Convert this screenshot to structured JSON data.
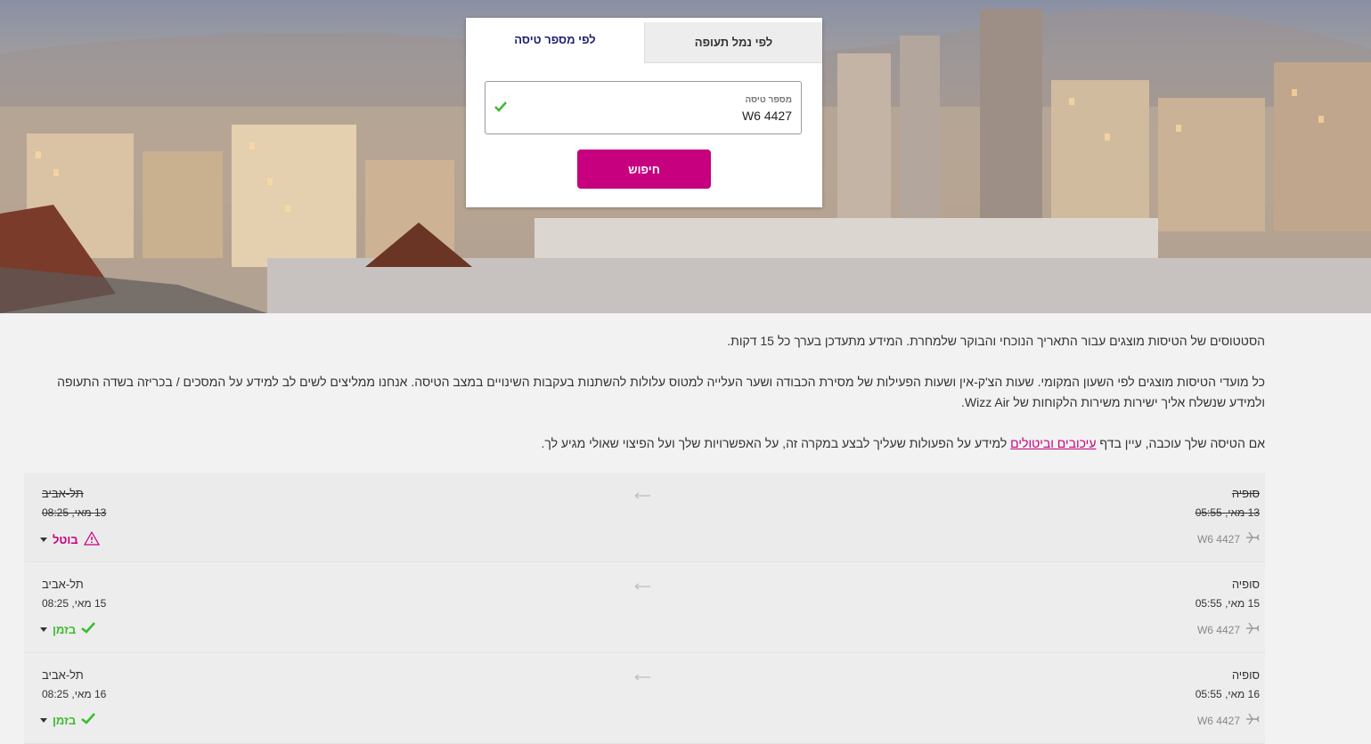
{
  "search": {
    "tab_by_flight": "לפי מספר טיסה",
    "tab_by_airport": "לפי נמל תעופה",
    "field_label": "מספר טיסה",
    "field_value": "W6 4427",
    "button_label": "חיפוש"
  },
  "info": {
    "line1": "הסטטוסים של הטיסות מוצגים עבור התאריך הנוכחי והבוקר שלמחרת. המידע מתעדכן בערך כל 15 דקות.",
    "line2": "כל מועדי הטיסות מוצגים לפי השעון המקומי. שעות הצ'ק-אין ושעות הפעילות של מסירת הכבודה ושער העלייה למטוס עלולות להשתנות בעקבות השינויים במצב הטיסה. אנחנו ממליצים לשים לב למידע על המסכים / בכריזה בשדה התעופה ולמידע שנשלח אליך ישירות משירות הלקוחות של Wizz Air.",
    "line3_before": "אם הטיסה שלך עוכבה, עיין בדף ",
    "line3_link": "עיכובים וביטולים",
    "line3_after": " למידע על הפעולות שעליך לבצע במקרה זה, על האפשרויות שלך ועל הפיצוי שאולי מגיע לך."
  },
  "flights": [
    {
      "departure_city": "סופיה",
      "departure_time": "13 מאי, 05:55",
      "arrival_city": "תל-אביב",
      "arrival_time": "13 מאי, 08:25",
      "flight_number": "W6 4427",
      "status": "בוטל",
      "status_kind": "cancelled"
    },
    {
      "departure_city": "סופיה",
      "departure_time": "15 מאי, 05:55",
      "arrival_city": "תל-אביב",
      "arrival_time": "15 מאי, 08:25",
      "flight_number": "W6 4427",
      "status": "בזמן",
      "status_kind": "on-time"
    },
    {
      "departure_city": "סופיה",
      "departure_time": "16 מאי, 05:55",
      "arrival_city": "תל-אביב",
      "arrival_time": "16 מאי, 08:25",
      "flight_number": "W6 4427",
      "status": "בזמן",
      "status_kind": "on-time"
    }
  ],
  "colors": {
    "brand": "#c6007e",
    "on_time": "#3dbb2f",
    "tab_active_text": "#1f1f6b"
  },
  "icons": {
    "field_valid": "check-icon",
    "route": "arrow-left-icon",
    "flight": "airplane-icon",
    "cancelled": "warning-icon",
    "on_time": "check-icon",
    "expand": "chevron-down-icon"
  }
}
